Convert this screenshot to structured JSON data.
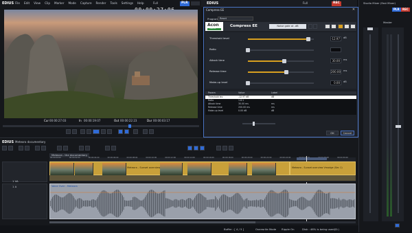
{
  "app": {
    "name": "EDIUS"
  },
  "menu": [
    "File",
    "Edit",
    "View",
    "Clip",
    "Marker",
    "Mode",
    "Capture",
    "Render",
    "Tools",
    "Settings",
    "Help"
  ],
  "player": {
    "mode": "Full",
    "badge": "PLR",
    "timecode": "00:00:27:06",
    "cur_label": "Cur",
    "cur_value": "00:00:27:03",
    "in_label": "In",
    "in_value": "00:00:19:07",
    "out_label": "Out",
    "out_value": "00:00:22:23",
    "dur_label": "Dur",
    "dur_value": "00:00:03:17"
  },
  "preview_window": {
    "app": "EDIUS",
    "mode": "Full",
    "badge": "REC"
  },
  "plugin": {
    "window_title": "Compress EE",
    "program_label": "Program",
    "program_value": "Reset",
    "logo_brand": "Acon",
    "logo_sub": "DIGITAL",
    "name": "Compress EE",
    "preset": "Noise gate at -dB",
    "params": [
      {
        "label": "Threshold level",
        "value": "-12.97",
        "unit": "dB",
        "level": 0.92
      },
      {
        "label": "Ratio",
        "value": "",
        "unit": "",
        "level": 0.0
      },
      {
        "label": "Attack time",
        "value": "30.00",
        "unit": "ms",
        "level": 0.55
      },
      {
        "label": "Release time",
        "value": "200.00",
        "unit": "ms",
        "level": 0.58
      },
      {
        "label": "Make-up level",
        "value": "0.00",
        "unit": "dB",
        "level": 0.0
      }
    ],
    "table_headers": [
      "Param",
      "Value",
      "Label"
    ],
    "table_rows": [
      [
        "Threshold lev",
        "-12.97 dB",
        "dB"
      ],
      [
        "Ratio",
        "1.6:1",
        ""
      ],
      [
        "Attack time",
        "30.00 ms",
        "ms"
      ],
      [
        "Release time",
        "200.00 ms",
        "ms"
      ],
      [
        "Make-up level",
        "0.00 dB",
        "dB"
      ]
    ],
    "ok": "OK",
    "cancel": "Cancel"
  },
  "mixer": {
    "title": "Studio Mixer (Fast Mixer)",
    "master": "Master",
    "badge": "PLR",
    "badge2": "REC"
  },
  "timeline": {
    "app": "EDIUS",
    "project": "Meteora documentary",
    "sequence": "Meteora - the documentary",
    "ruler": [
      "00:00:00:00",
      "00:00:02:00",
      "00:00:04:00",
      "00:00:06:00",
      "00:00:08:00",
      "00:00:10:00",
      "00:00:12:00",
      "00:00:14:00",
      "00:00:16:00",
      "00:00:18:00",
      "00:00:20:00",
      "00:00:22:00",
      "00:00:24:00",
      "00:00:26:00",
      "00:00:28:00",
      "00:00:30:00"
    ],
    "tracks": [
      {
        "name": "1 VA"
      },
      {
        "name": "1 A"
      }
    ],
    "video_clips": [
      {
        "label": "Meteora - Sunset overview"
      },
      {
        "label": "Meteora - Sunset overview Vmodge (Sec 1)"
      }
    ],
    "audio_clip_label": "Voice Over - Meteora"
  },
  "status": {
    "buffer": "Buffer : [  4 / 5 ]",
    "mode": "Overwrite Mode",
    "ripple": "Ripple On",
    "disk": "Disk : 46% is being used(D:)"
  },
  "accent": "#d9a020"
}
